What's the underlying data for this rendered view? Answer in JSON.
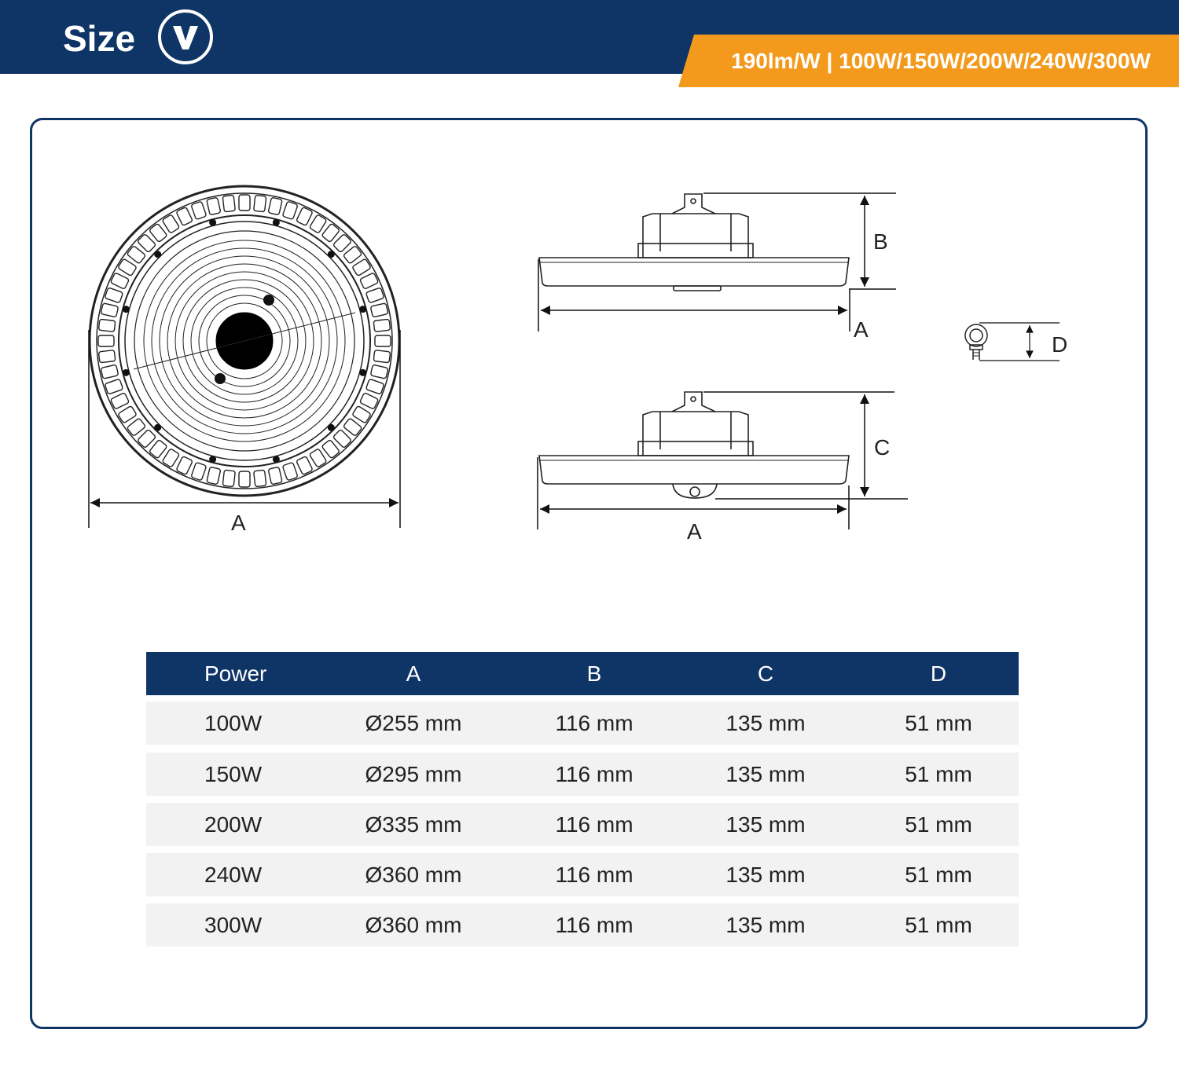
{
  "header": {
    "title": "Size",
    "logo": "v-logo-icon",
    "spec_banner": "190lm/W | 100W/150W/200W/240W/300W"
  },
  "drawing": {
    "front_view_dimension": "A",
    "side_view_top_dimensions": [
      "B",
      "A"
    ],
    "side_view_bottom_dimensions": [
      "C",
      "A"
    ],
    "eyebolt_dimension": "D"
  },
  "table": {
    "headers": [
      "Power",
      "A",
      "B",
      "C",
      "D"
    ],
    "rows": [
      [
        "100W",
        "Ø255 mm",
        "116 mm",
        "135 mm",
        "51 mm"
      ],
      [
        "150W",
        "Ø295 mm",
        "116 mm",
        "135 mm",
        "51 mm"
      ],
      [
        "200W",
        "Ø335 mm",
        "116 mm",
        "135 mm",
        "51 mm"
      ],
      [
        "240W",
        "Ø360 mm",
        "116 mm",
        "135 mm",
        "51 mm"
      ],
      [
        "300W",
        "Ø360 mm",
        "116 mm",
        "135 mm",
        "51 mm"
      ]
    ]
  },
  "colors": {
    "navy": "#0e3566",
    "orange": "#f39a1c",
    "row_bg": "#f2f2f2"
  }
}
